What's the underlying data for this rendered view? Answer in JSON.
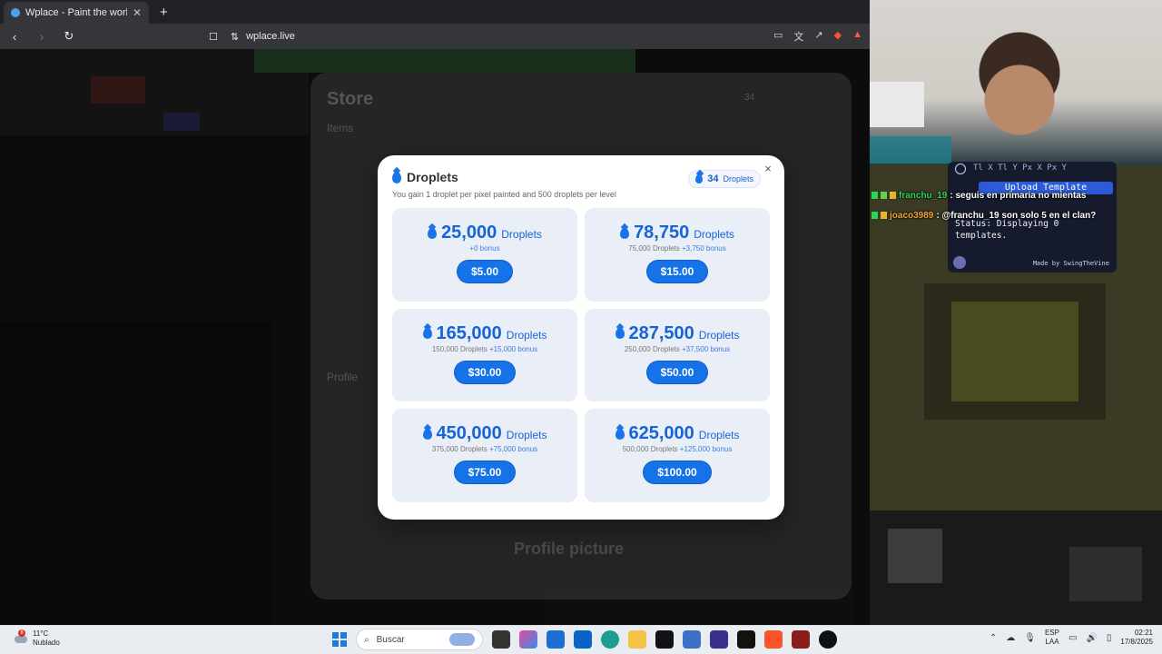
{
  "browser": {
    "tab_title": "Wplace - Paint the world",
    "tab_close": "✕",
    "new_tab": "+",
    "url": "wplace.live",
    "back": "‹",
    "forward": "›",
    "reload": "↻",
    "bookmark": "☐",
    "site_info": "⇅",
    "tools": [
      "▭",
      "文",
      "↗",
      "▲"
    ]
  },
  "store_bg": {
    "title": "Store",
    "items": "Items",
    "profile": "Profile",
    "profile_picture": "Profile picture",
    "balance": "34"
  },
  "modal": {
    "title": "Droplets",
    "balance_value": "34",
    "balance_label": "Droplets",
    "close": "×",
    "description": "You gain 1 droplet per pixel painted and 500 droplets per level",
    "packages": [
      {
        "amount": "25,000",
        "unit": "Droplets",
        "base": "",
        "bonus": "+0 bonus",
        "price": "$5.00"
      },
      {
        "amount": "78,750",
        "unit": "Droplets",
        "base": "75,000 Droplets",
        "bonus": "+3,750 bonus",
        "price": "$15.00"
      },
      {
        "amount": "165,000",
        "unit": "Droplets",
        "base": "150,000 Droplets",
        "bonus": "+15,000 bonus",
        "price": "$30.00"
      },
      {
        "amount": "287,500",
        "unit": "Droplets",
        "base": "250,000 Droplets",
        "bonus": "+37,500 bonus",
        "price": "$50.00"
      },
      {
        "amount": "450,000",
        "unit": "Droplets",
        "base": "375,000 Droplets",
        "bonus": "+75,000 bonus",
        "price": "$75.00"
      },
      {
        "amount": "625,000",
        "unit": "Droplets",
        "base": "500,000 Droplets",
        "bonus": "+125,000 bonus",
        "price": "$100.00"
      }
    ],
    "accent_color": "#1572e8"
  },
  "template_overlay": {
    "coords": "Tl X  Tl Y  Px X  Px Y",
    "upload": "Upload Template",
    "status": "Status: Displaying 0 templates.",
    "made_by": "Made by SwingTheVine"
  },
  "chat": [
    {
      "user": "franchu_19",
      "message": ": seguis en primaria no mientas"
    },
    {
      "user": "joaco3989",
      "message": ": @franchu_19 son solo 5 en el clan?"
    }
  ],
  "taskbar": {
    "weather_temp": "11°C",
    "weather_desc": "Nublado",
    "weather_badge": "8",
    "search": "Buscar",
    "lang_top": "ESP",
    "lang_bottom": "LAA",
    "time": "02:21",
    "date": "17/8/2025"
  }
}
